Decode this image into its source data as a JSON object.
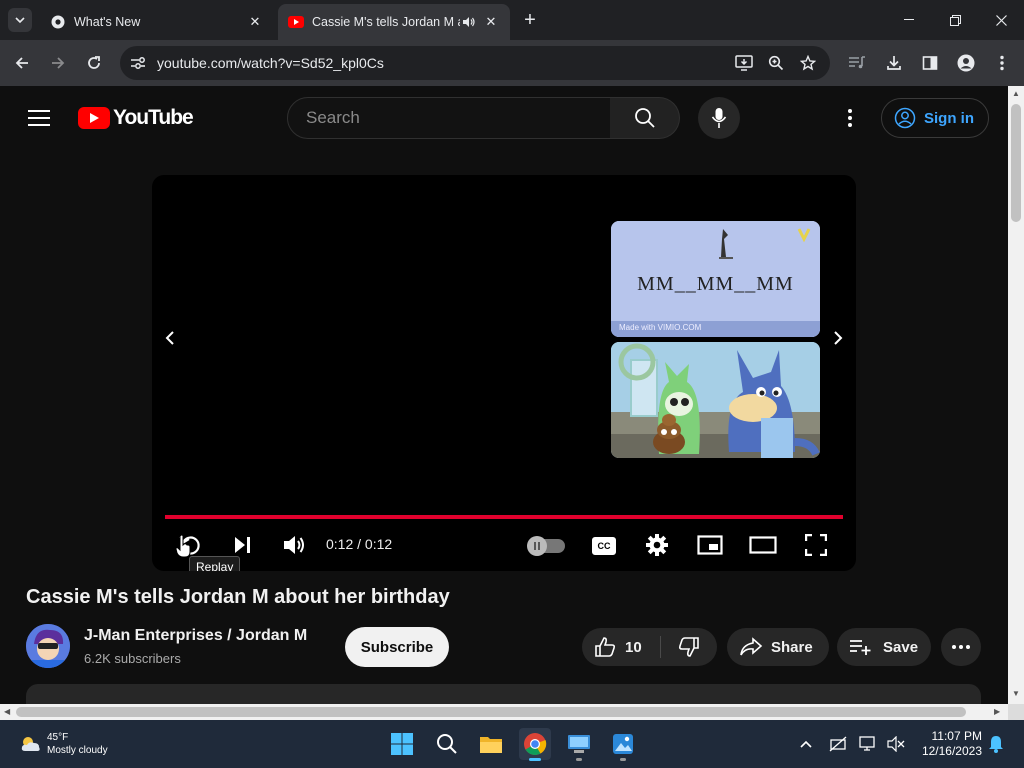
{
  "browser": {
    "tabs": [
      {
        "title": "What's New",
        "active": false
      },
      {
        "title": "Cassie M's tells Jordan M about her birthday",
        "active": true
      }
    ],
    "url": "youtube.com/watch?v=Sd52_kpl0Cs"
  },
  "youtube": {
    "logo_text": "YouTube",
    "search_placeholder": "Search",
    "sign_in_label": "Sign in"
  },
  "player": {
    "end_screen_text": "MM__MM__MM",
    "thumb_watermark": "Made with VIMIO.COM",
    "time": "0:12 / 0:12",
    "progress": 1.0,
    "tooltip": "Replay",
    "cc_label": "CC"
  },
  "video": {
    "title": "Cassie M's tells Jordan M about her birthday",
    "channel_name": "J-Man Enterprises / Jordan M",
    "subscribers": "6.2K subscribers",
    "subscribe_label": "Subscribe",
    "likes": "10",
    "share_label": "Share",
    "save_label": "Save"
  },
  "taskbar": {
    "weather_temp": "45°F",
    "weather_desc": "Mostly cloudy",
    "time": "11:07 PM",
    "date": "12/16/2023"
  },
  "colors": {
    "youtube_red": "#ff0000",
    "progress_red": "#e1002d",
    "link_blue": "#3ea6ff",
    "page_bg": "#0f0f0f"
  }
}
